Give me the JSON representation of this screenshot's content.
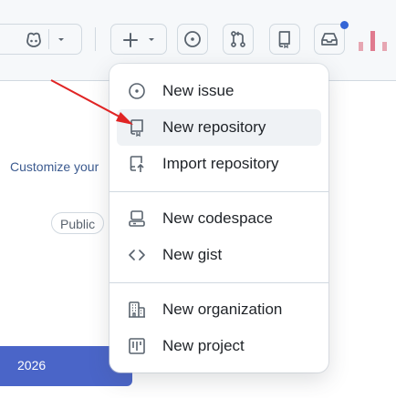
{
  "menu": {
    "items": [
      {
        "label": "New issue",
        "icon": "issue-opened-icon"
      },
      {
        "label": "New repository",
        "icon": "repo-icon"
      },
      {
        "label": "Import repository",
        "icon": "repo-push-icon"
      },
      {
        "label": "New codespace",
        "icon": "codespaces-icon"
      },
      {
        "label": "New gist",
        "icon": "code-icon"
      },
      {
        "label": "New organization",
        "icon": "organization-icon"
      },
      {
        "label": "New project",
        "icon": "project-icon"
      }
    ]
  },
  "page": {
    "customize_text": "Customize your",
    "public_badge": "Public",
    "year": "2026"
  },
  "colors": {
    "accent_blue": "#4a65c8",
    "annotation_arrow": "#e02424",
    "notification_dot": "#3566d6"
  }
}
